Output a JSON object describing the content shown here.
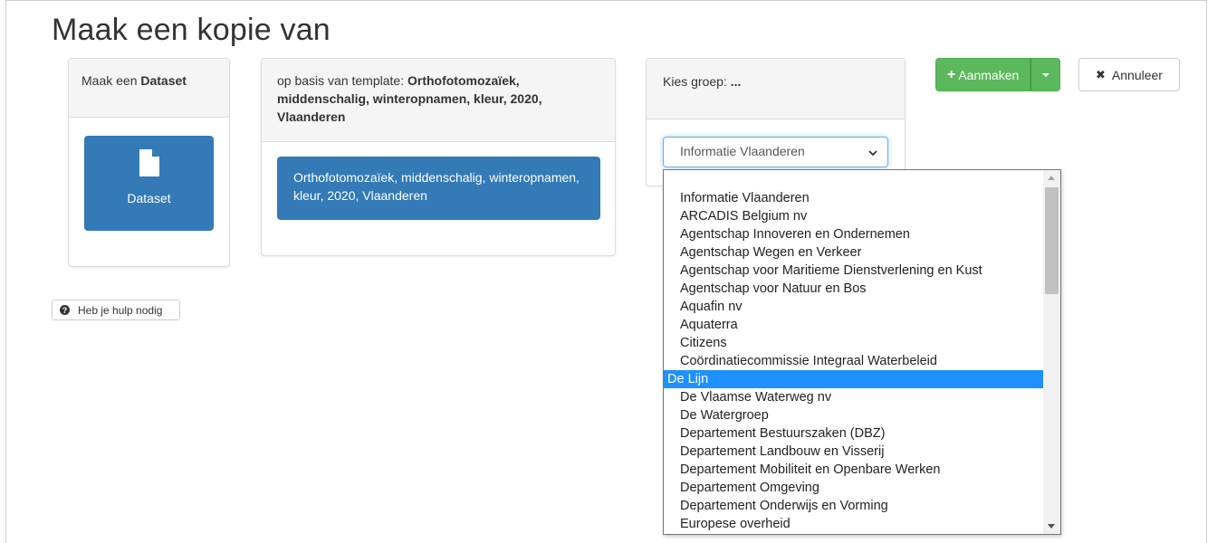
{
  "page": {
    "title": "Maak een kopie van"
  },
  "panel_type": {
    "heading_prefix": "Maak een",
    "heading_bold": "Dataset",
    "tile_label": "Dataset",
    "tile_icon": "file-icon"
  },
  "panel_template": {
    "heading_prefix": "op basis van template:",
    "heading_bold": "Orthofotomozaïek, middenschalig, winteropnamen, kleur, 2020, Vlaanderen",
    "tile_label": "Orthofotomozaïek, middenschalig, winteropnamen, kleur, 2020, Vlaanderen"
  },
  "panel_group": {
    "heading_prefix": "Kies groep:",
    "heading_bold": "...",
    "select_value": "Informatie Vlaanderen"
  },
  "buttons": {
    "create_label": "Aanmaken",
    "cancel_label": "Annuleer",
    "help_label": "Heb je hulp nodig"
  },
  "colors": {
    "primary": "#337ab7",
    "success": "#5cb85c",
    "selection": "#1e90ff"
  },
  "group_options": [
    "Informatie Vlaanderen",
    "ARCADIS Belgium nv",
    "Agentschap Innoveren en Ondernemen",
    "Agentschap Wegen en Verkeer",
    "Agentschap voor Maritieme Dienstverlening en Kust",
    "Agentschap voor Natuur en Bos",
    "Aquafin nv",
    "Aquaterra",
    "Citizens",
    "Coördinatiecommissie Integraal Waterbeleid",
    "De Lijn",
    "De Vlaamse Waterweg nv",
    "De Watergroep",
    "Departement Bestuurszaken (DBZ)",
    "Departement Landbouw en Visserij",
    "Departement Mobiliteit en Openbare Werken",
    "Departement Omgeving",
    "Departement Onderwijs en Vorming",
    "Europese overheid"
  ],
  "highlighted_option": "De Lijn"
}
